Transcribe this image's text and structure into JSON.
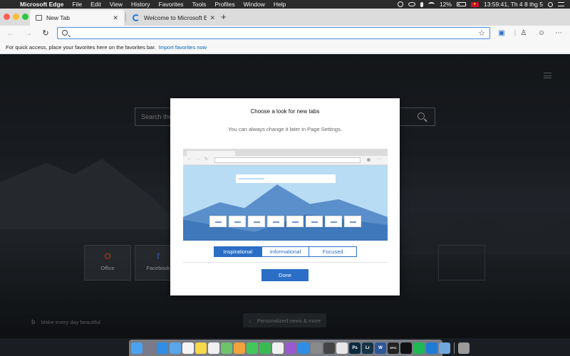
{
  "menubar": {
    "app_name": "Microsoft Edge",
    "menus": [
      "File",
      "Edit",
      "View",
      "History",
      "Favorites",
      "Tools",
      "Profiles",
      "Window",
      "Help"
    ],
    "battery_percent": "12%",
    "clock": "13:59:41, Th 4 8 thg 5"
  },
  "browser": {
    "tabs": [
      {
        "label": "New Tab",
        "active": true
      },
      {
        "label": "Welcome to Microsoft Edge De",
        "active": false
      }
    ],
    "new_tab_label": "+",
    "close_glyph": "✕",
    "address": {
      "value": "",
      "placeholder": ""
    }
  },
  "favorites_bar": {
    "message": "For quick access, place your favorites here on the favorites bar.",
    "import_link": "Import favorites now"
  },
  "new_tab_page": {
    "search_placeholder": "Search the",
    "tiles": [
      {
        "label": "Office",
        "glyph": "O"
      },
      {
        "label": "Facebook",
        "glyph": "f"
      }
    ],
    "bing_tagline": "Make every day beautiful",
    "news_button": "Personalized news & more"
  },
  "dialog": {
    "title": "Choose a look for new tabs",
    "subtitle": "You can always change it later in Page Settings.",
    "options": [
      {
        "label": "Inspirational",
        "selected": true
      },
      {
        "label": "Informational",
        "selected": false
      },
      {
        "label": "Focused",
        "selected": false
      }
    ],
    "done_label": "Done"
  },
  "dock": {
    "icons": [
      {
        "name": "finder-icon",
        "color": "#4aa3f0"
      },
      {
        "name": "launchpad-icon",
        "color": "#7a7a8a"
      },
      {
        "name": "safari-icon",
        "color": "#2f8fe6"
      },
      {
        "name": "mail-icon",
        "color": "#5aa6e8"
      },
      {
        "name": "calendar-icon",
        "color": "#f4f4f4"
      },
      {
        "name": "notes-icon",
        "color": "#f5d94a"
      },
      {
        "name": "reminders-icon",
        "color": "#f0f0f0"
      },
      {
        "name": "maps-icon",
        "color": "#6cc36b"
      },
      {
        "name": "photos-icon",
        "color": "#f2a23c"
      },
      {
        "name": "messages-icon",
        "color": "#44c75a"
      },
      {
        "name": "facetime-icon",
        "color": "#3aba52"
      },
      {
        "name": "music-icon",
        "color": "#f0f0f0"
      },
      {
        "name": "podcasts-icon",
        "color": "#9b59d0"
      },
      {
        "name": "appstore-icon",
        "color": "#2f8fe6"
      },
      {
        "name": "preferences-icon",
        "color": "#8a8a8a"
      },
      {
        "name": "activity-monitor-icon",
        "color": "#444444"
      },
      {
        "name": "chrome-icon",
        "color": "#e7e7e7"
      },
      {
        "name": "photoshop-icon",
        "color": "#0b2a3e",
        "text": "Ps"
      },
      {
        "name": "lightroom-icon",
        "color": "#163346",
        "text": "Lr"
      },
      {
        "name": "word-icon",
        "color": "#2b579a",
        "text": "W"
      },
      {
        "name": "epic-games-icon",
        "color": "#222222",
        "text": "EPIC"
      },
      {
        "name": "terminal-icon",
        "color": "#111111"
      },
      {
        "name": "spotify-icon",
        "color": "#1db954"
      },
      {
        "name": "edge-icon",
        "color": "#1f7ad8"
      },
      {
        "name": "folder-icon",
        "color": "#6fa8dc"
      }
    ],
    "trash": {
      "name": "trash-icon",
      "color": "#9a9a9a"
    }
  }
}
